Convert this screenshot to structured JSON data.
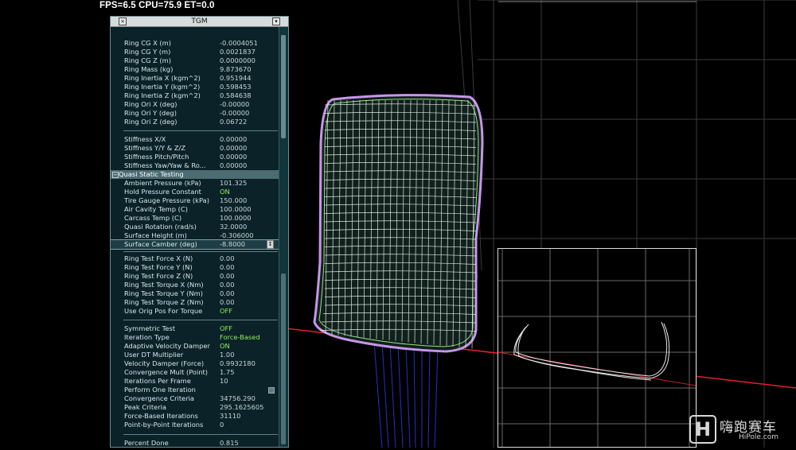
{
  "status_bar": {
    "text": "FPS=6.5 CPU=75.9 ET=0.0"
  },
  "panel": {
    "title": "TGM",
    "close_glyph": "×",
    "menu_glyph": "▾",
    "rows": [
      {
        "label": "Ring CG X (m)",
        "value": "-0.0004051"
      },
      {
        "label": "Ring CG Y (m)",
        "value": "0.0021837"
      },
      {
        "label": "Ring CG Z (m)",
        "value": "0.0000000"
      },
      {
        "label": "Ring Mass (kg)",
        "value": "9.873670"
      },
      {
        "label": "Ring Inertia X (kgm^2)",
        "value": "0.951944"
      },
      {
        "label": "Ring Inertia Y (kgm^2)",
        "value": "0.598453"
      },
      {
        "label": "Ring Inertia Z (kgm^2)",
        "value": "0.584638"
      },
      {
        "label": "Ring Ori X (deg)",
        "value": "-0.00000"
      },
      {
        "label": "Ring Ori Y (deg)",
        "value": "-0.00000"
      },
      {
        "label": "Ring Ori Z (deg)",
        "value": "0.06722"
      },
      {
        "label": "Stiffness X/X",
        "value": "0.00000"
      },
      {
        "label": "Stiffness Y/Y & Z/Z",
        "value": "0.00000"
      },
      {
        "label": "Stiffness Pitch/Pitch",
        "value": "0.00000"
      },
      {
        "label": "Stiffness Yaw/Yaw & Ro...",
        "value": "0.00000"
      },
      {
        "group": "Quasi Static Testing",
        "toggle": "−"
      },
      {
        "label": "Ambient Pressure (kPa)",
        "value": "101.325"
      },
      {
        "label": "Hold Pressure Constant",
        "value": "ON",
        "state": "on"
      },
      {
        "label": "Tire Gauge Pressure (kPa)",
        "value": "150.000"
      },
      {
        "label": "Air Cavity Temp (C)",
        "value": "100.0000"
      },
      {
        "label": "Carcass Temp (C)",
        "value": "100.0000"
      },
      {
        "label": "Quasi Rotation (rad/s)",
        "value": "32.0000"
      },
      {
        "label": "Surface Height (m)",
        "value": "-0.306000"
      },
      {
        "label": "Surface Camber (deg)",
        "value": "-8.8000",
        "edit": true,
        "spin": "↕"
      },
      {
        "label": "Ring Test Force X (N)",
        "value": "0.00"
      },
      {
        "label": "Ring Test Force Y (N)",
        "value": "0.00"
      },
      {
        "label": "Ring Test Force Z (N)",
        "value": "0.00"
      },
      {
        "label": "Ring Test Torque X (Nm)",
        "value": "0.00"
      },
      {
        "label": "Ring Test Torque Y (Nm)",
        "value": "0.00"
      },
      {
        "label": "Ring Test Torque Z (Nm)",
        "value": "0.00"
      },
      {
        "label": "Use Orig Pos For Torque",
        "value": "OFF",
        "state": "on"
      },
      {
        "label": "Symmetric Test",
        "value": "OFF",
        "state": "on"
      },
      {
        "label": "Iteration Type",
        "value": "Force-Based",
        "state": "on"
      },
      {
        "label": "Adaptive Velocity Damper",
        "value": "ON",
        "state": "on"
      },
      {
        "label": "User DT Multiplier",
        "value": "1.00"
      },
      {
        "label": "Velocity Damper (Force)",
        "value": "0.9932180"
      },
      {
        "label": "Convergence Mult (Point)",
        "value": "1.75"
      },
      {
        "label": "Iterations Per Frame",
        "value": "10"
      },
      {
        "label": "Perform One Iteration",
        "value": "",
        "checkbox": true
      },
      {
        "label": "Convergence Criteria",
        "value": "34756.290"
      },
      {
        "label": "Peak Criteria",
        "value": "295.1625605"
      },
      {
        "label": "Force-Based Iterations",
        "value": "31110"
      },
      {
        "label": "Point-by-Point Iterations",
        "value": "0"
      },
      {
        "label": "Percent Done",
        "value": "0.815"
      }
    ]
  },
  "watermark": {
    "mark": "H",
    "cn": "嗨跑赛车",
    "en": "HiPole.com"
  },
  "colors": {
    "panel_bg": "#0b2228",
    "group_bg": "#4d6b72",
    "value_on": "#8ff05a",
    "tire_mesh": "#dfe6e8",
    "tire_outline": "#c796e8",
    "tire_inner": "#9be08a",
    "road_line": "#e0222b",
    "grid": "#4a4a4a"
  }
}
